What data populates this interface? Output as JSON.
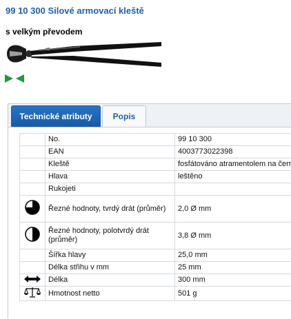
{
  "product": {
    "title": "99 10 300 Silové armovací kleště",
    "subtitle": "s velkým převodem"
  },
  "tabs": [
    {
      "label": "Technické atributy"
    },
    {
      "label": "Popis"
    }
  ],
  "attributes": [
    {
      "icon": "",
      "name": "No.",
      "value": "99 10 300"
    },
    {
      "icon": "",
      "name": "EAN",
      "value": "4003773022398"
    },
    {
      "icon": "",
      "name": "Kleště",
      "value": "fosfátováno atramentolem na černo"
    },
    {
      "icon": "",
      "name": "Hlava",
      "value": "leštěno"
    },
    {
      "icon": "",
      "name": "Rukojeti",
      "value": ""
    },
    {
      "icon": "hard-wire-icon",
      "name": "Řezné hodnoty, tvrdý drát (průměr)",
      "value": "2,0 Ø mm"
    },
    {
      "icon": "medium-hard-wire-icon",
      "name": "Řezné hodnoty, polotvrdý drát (průměr)",
      "value": "3,8 Ø mm"
    },
    {
      "icon": "",
      "name": "Šířka hlavy",
      "value": "25,0 mm"
    },
    {
      "icon": "",
      "name": "Délka střihu v mm",
      "value": "25 mm"
    },
    {
      "icon": "length-arrow-icon",
      "name": "Délka",
      "value": "300 mm"
    },
    {
      "icon": "scale-icon",
      "name": "Hmotnost netto",
      "value": "501 g"
    }
  ],
  "colors": {
    "title": "#1f5fa8",
    "tab_active": "#1a64b4",
    "border": "#d3d8de",
    "logo": "#1e9a3a"
  }
}
